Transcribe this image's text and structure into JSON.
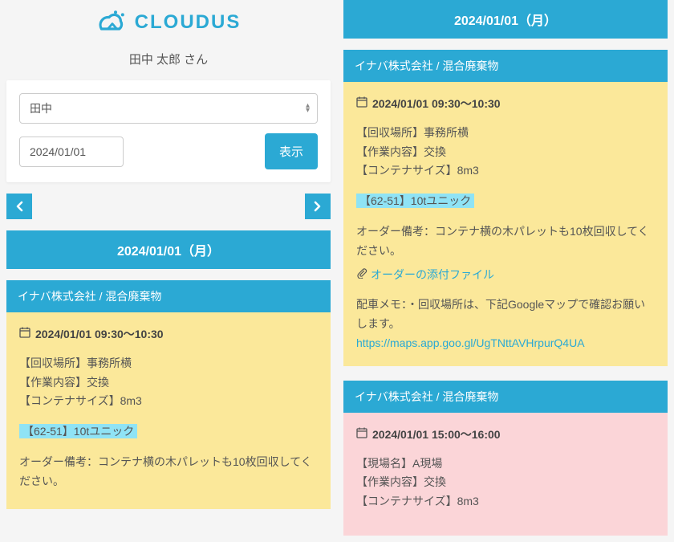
{
  "logo_text": "CLOUDUS",
  "username": "田中 太郎 さん",
  "filter": {
    "driver_selected": "田中",
    "date_value": "2024/01/01",
    "show_button": "表示"
  },
  "date_header": "2024/01/01（月）",
  "job1": {
    "title": "イナバ株式会社 / 混合廃棄物",
    "time": "2024/01/01 09:30～10:30",
    "f1": "【回収場所】事務所横",
    "f2": "【作業内容】交換",
    "f3": "【コンテナサイズ】8m3",
    "vehicle": "【62-51】10tユニック",
    "note": "オーダー備考：コンテナ横の木パレットも10枚回収してください。",
    "attach": "オーダーの添付ファイル",
    "memo_label": "配車メモ：・回収場所は、下記Googleマップで確認お願いします。",
    "link": "https://maps.app.goo.gl/UgTNttAVHrpurQ4UA"
  },
  "job2": {
    "title": "イナバ株式会社 / 混合廃棄物",
    "time": "2024/01/01 15:00～16:00",
    "f1": "【現場名】A現場",
    "f2": "【作業内容】交換",
    "f3": "【コンテナサイズ】8m3"
  }
}
